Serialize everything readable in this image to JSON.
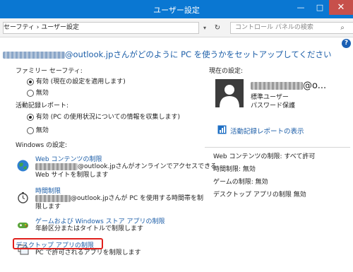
{
  "window": {
    "title": "ユーザー設定",
    "min": "—",
    "max": "□",
    "close": "✕"
  },
  "address": {
    "breadcrumb": "セーフティ › ユーザー設定",
    "dropdown_glyph": "▾",
    "refresh_glyph": "↻",
    "search_placeholder": "コントロール パネルの検索",
    "search_glyph": "⌕"
  },
  "help_label": "?",
  "heading": {
    "text": "@outlook.jpさんがどのように PC を使うかをセットアップしてください"
  },
  "family_safety": {
    "label": "ファミリー セーフティ:",
    "on": "有効 (現在の設定を適用します)",
    "off": "無効"
  },
  "activity_report": {
    "label": "活動記録レポート:",
    "on": "有効 (PC の使用状況についての情報を収集します)",
    "off": "無効"
  },
  "windows_settings": {
    "label": "Windows の設定:",
    "items": [
      {
        "title": "Web コンテンツの制限",
        "desc1": "@outlook.jpさんがオンラインでアクセスできる",
        "desc2": "Web サイトを制限します"
      },
      {
        "title": "時間制限",
        "desc1": "@outlook.jpさんが PC を使用する時間帯を制",
        "desc2": "限します"
      },
      {
        "title": "ゲームおよび Windows ストア アプリの制限",
        "desc1": "年齢区分またはタイトルで制限します"
      },
      {
        "title": "デスクトップ アプリの制限",
        "desc1": "PC で許可されるアプリを制限します"
      }
    ]
  },
  "current_settings": {
    "label": "現在の設定:",
    "user_suffix": "@o...",
    "account_type": "標準ユーザー",
    "password": "パスワード保護",
    "report_link": "活動記録レポートの表示",
    "rows": [
      "Web コンテンツの制限: すべて許可",
      "時間制限: 無効",
      "ゲームの制限: 無効",
      "デスクトップ アプリの制限 無効"
    ]
  },
  "colors": {
    "titlebar": "#0a77d2",
    "link": "#1c5ea8",
    "highlight": "#e0201d"
  }
}
